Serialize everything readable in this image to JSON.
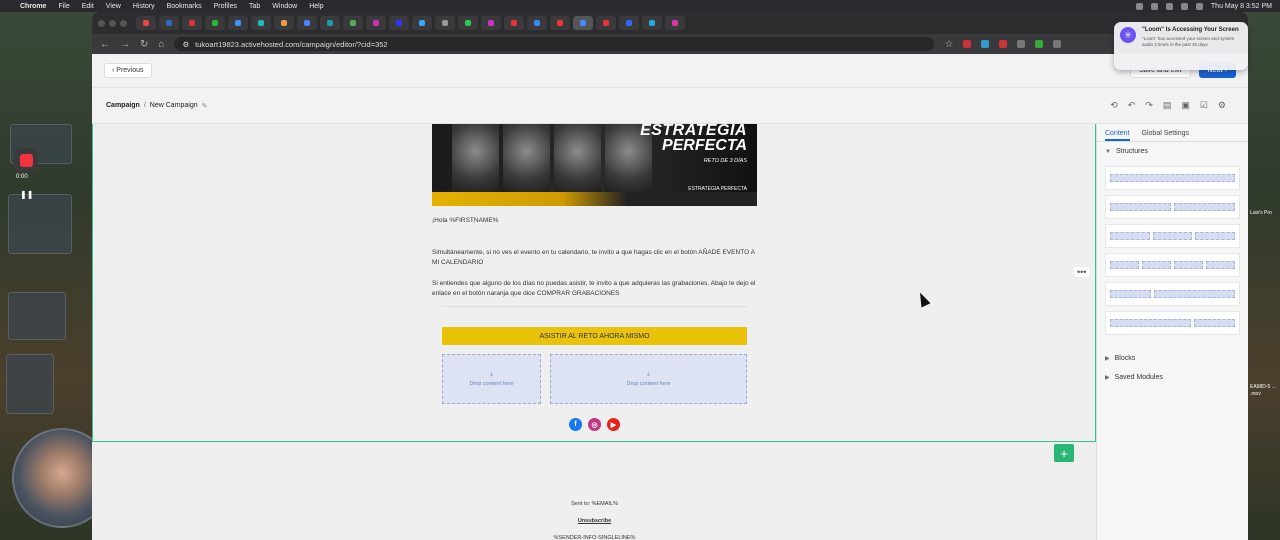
{
  "menubar": {
    "app": "Chrome",
    "items": [
      "File",
      "Edit",
      "View",
      "History",
      "Bookmarks",
      "Profiles",
      "Tab",
      "Window",
      "Help"
    ],
    "clock": "Thu May 8  3:52 PM"
  },
  "browser": {
    "url": "tukoart19823.activehosted.com/campaign/editor/?cid=352"
  },
  "header": {
    "previous_label": "Previous",
    "save_exit_label": "Save and exit",
    "next_label": "Next"
  },
  "breadcrumb": {
    "root": "Campaign",
    "sep": "/",
    "current": "New Campaign"
  },
  "email": {
    "banner_title_1": "ESTRATEGIA",
    "banner_title_2": "PERFECTA",
    "banner_subtitle": "RETO DE 3 DÍAS",
    "banner_logo": "ESTRATEGIA PERFECTA",
    "greeting": "¡Hola %FIRSTNAME%",
    "paragraph_1": "Simultáneamente, si no ves el evento en tu calendario, te invito a que hagas clic en el botón AÑADE EVENTO A MI CALENDARIO",
    "paragraph_2": "Si entiendes que alguno de los días no puedas asistir, te invito a que adquieras las grabaciones. Abajo te dejo el enlace en el botón naranja que dice COMPRAR GRABACIONES",
    "cta_label": "ASISTIR AL RETO AHORA MISMO",
    "drop_label_1": "Drop content here",
    "drop_label_2": "Drop content here"
  },
  "footer": {
    "sent_to": "Sent to: %EMAIL%",
    "unsubscribe": "Unsubscribe",
    "sender_info": "%SENDER-INFO-SINGLELINE%"
  },
  "panel": {
    "tab_content": "Content",
    "tab_global": "Global Settings",
    "structures": "Structures",
    "blocks": "Blocks",
    "saved_modules": "Saved Modules"
  },
  "loom": {
    "title": "\"Loom\" Is Accessing Your Screen",
    "body": "\"Loom\" has accessed your screen and system audio 3 times in the past 30 days"
  },
  "desktop": {
    "timer": "0:00",
    "right_label_1": "Luis's Pro",
    "right_label_2": "EA98D-5 ... .mov"
  },
  "colors": {
    "accent_blue": "#1a64d6",
    "cta_yellow": "#e8c30a",
    "outline_green": "#3bbf8a",
    "facebook": "#1877f2",
    "instagram": "#c13584",
    "youtube": "#e62117"
  }
}
